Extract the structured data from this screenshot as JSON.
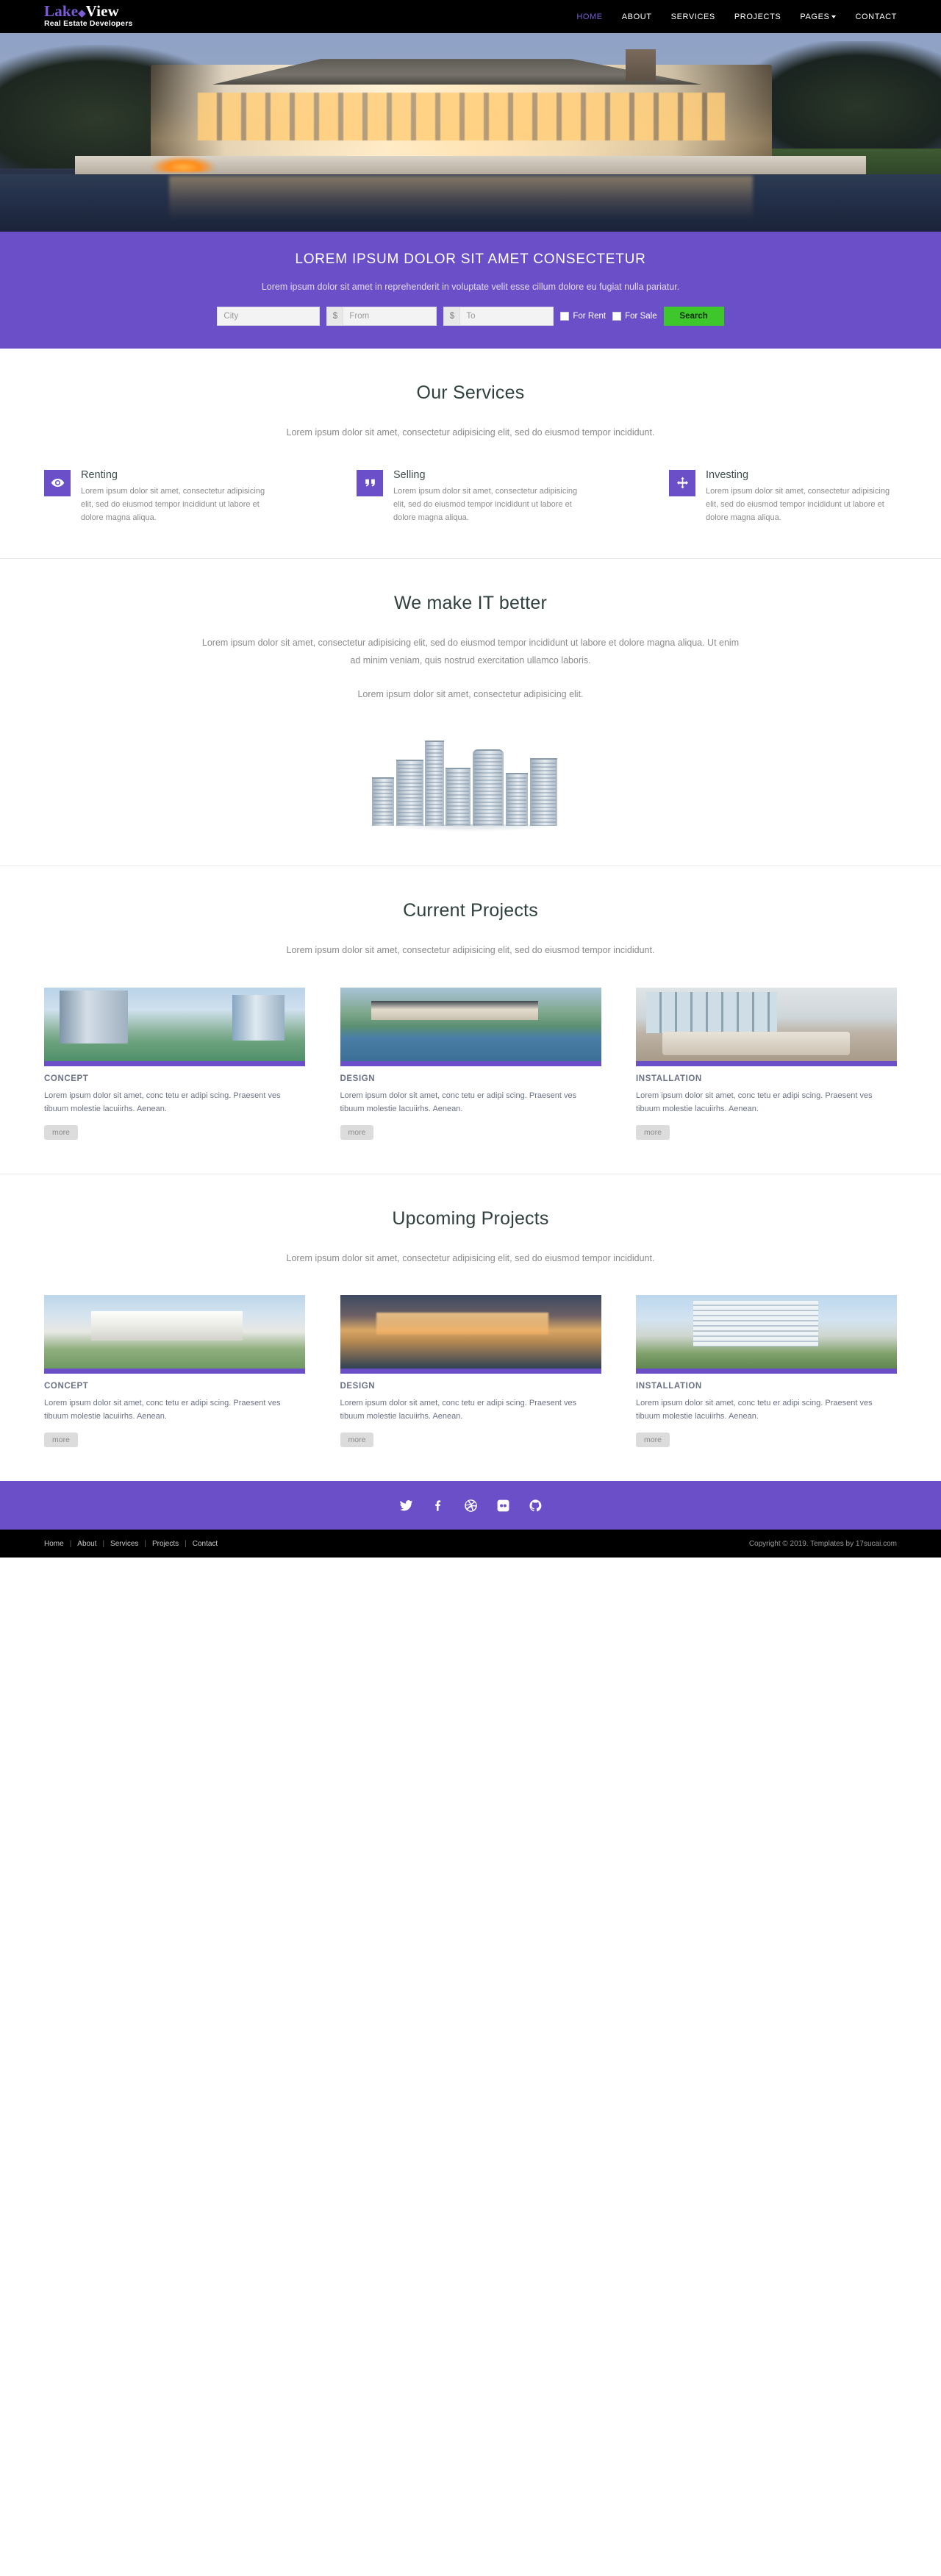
{
  "brand": {
    "name_first": "Lake",
    "name_second": "View",
    "tagline": "Real Estate Developers",
    "accent_color": "#7b5cd6"
  },
  "nav": {
    "items": [
      {
        "label": "HOME",
        "active": true
      },
      {
        "label": "ABOUT",
        "active": false
      },
      {
        "label": "SERVICES",
        "active": false
      },
      {
        "label": "PROJECTS",
        "active": false,
        "has_dropdown": false
      },
      {
        "label": "PAGES",
        "active": false,
        "has_dropdown": true
      },
      {
        "label": "CONTACT",
        "active": false
      }
    ]
  },
  "banner": {
    "headline": "LOREM IPSUM DOLOR SIT AMET CONSECTETUR",
    "subtext": "Lorem ipsum dolor sit amet in reprehenderit in voluptate velit esse cillum dolore eu fugiat nulla pariatur.",
    "background_color": "#6b4fc8",
    "search": {
      "city_placeholder": "City",
      "currency_symbol": "$",
      "from_placeholder": "From",
      "to_placeholder": "To",
      "for_rent_label": "For Rent",
      "for_sale_label": "For Sale",
      "button_label": "Search",
      "button_color": "#3ec72a"
    }
  },
  "services": {
    "title": "Our Services",
    "lead": "Lorem ipsum dolor sit amet, consectetur adipisicing elit, sed do eiusmod tempor incididunt.",
    "items": [
      {
        "icon": "eye-icon",
        "title": "Renting",
        "text": "Lorem ipsum dolor sit amet, consectetur adipisicing elit, sed do eiusmod tempor incididunt ut labore et dolore magna aliqua."
      },
      {
        "icon": "quote-icon",
        "title": "Selling",
        "text": "Lorem ipsum dolor sit amet, consectetur adipisicing elit, sed do eiusmod tempor incididunt ut labore et dolore magna aliqua."
      },
      {
        "icon": "move-arrows-icon",
        "title": "Investing",
        "text": "Lorem ipsum dolor sit amet, consectetur adipisicing elit, sed do eiusmod tempor incididunt ut labore et dolore magna aliqua."
      }
    ]
  },
  "about": {
    "title": "We make IT better",
    "paragraph1": "Lorem ipsum dolor sit amet, consectetur adipisicing elit, sed do eiusmod tempor incididunt ut labore et dolore magna aliqua. Ut enim ad minim veniam, quis nostrud exercitation ullamco laboris.",
    "paragraph2": "Lorem ipsum dolor sit amet, consectetur adipisicing elit."
  },
  "current_projects": {
    "title": "Current Projects",
    "lead": "Lorem ipsum dolor sit amet, consectetur adipisicing elit, sed do eiusmod tempor incididunt.",
    "cards": [
      {
        "title": "CONCEPT",
        "text": "Lorem ipsum dolor sit amet, conc tetu er adipi scing. Praesent ves tibuum molestie lacuiirhs. Aenean.",
        "button_label": "more"
      },
      {
        "title": "DESIGN",
        "text": "Lorem ipsum dolor sit amet, conc tetu er adipi scing. Praesent ves tibuum molestie lacuiirhs. Aenean.",
        "button_label": "more"
      },
      {
        "title": "INSTALLATION",
        "text": "Lorem ipsum dolor sit amet, conc tetu er adipi scing. Praesent ves tibuum molestie lacuiirhs. Aenean.",
        "button_label": "more"
      }
    ]
  },
  "upcoming_projects": {
    "title": "Upcoming Projects",
    "lead": "Lorem ipsum dolor sit amet, consectetur adipisicing elit, sed do eiusmod tempor incididunt.",
    "cards": [
      {
        "title": "CONCEPT",
        "text": "Lorem ipsum dolor sit amet, conc tetu er adipi scing. Praesent ves tibuum molestie lacuiirhs. Aenean.",
        "button_label": "more"
      },
      {
        "title": "DESIGN",
        "text": "Lorem ipsum dolor sit amet, conc tetu er adipi scing. Praesent ves tibuum molestie lacuiirhs. Aenean.",
        "button_label": "more"
      },
      {
        "title": "INSTALLATION",
        "text": "Lorem ipsum dolor sit amet, conc tetu er adipi scing. Praesent ves tibuum molestie lacuiirhs. Aenean.",
        "button_label": "more"
      }
    ]
  },
  "footer": {
    "social": [
      {
        "name": "twitter-icon"
      },
      {
        "name": "facebook-icon"
      },
      {
        "name": "dribbble-icon"
      },
      {
        "name": "flickr-icon"
      },
      {
        "name": "github-icon"
      }
    ],
    "links": [
      "Home",
      "About",
      "Services",
      "Projects",
      "Contact"
    ],
    "separator": "|",
    "copyright": "Copyright © 2019.  Templates  by 17sucai.com"
  }
}
